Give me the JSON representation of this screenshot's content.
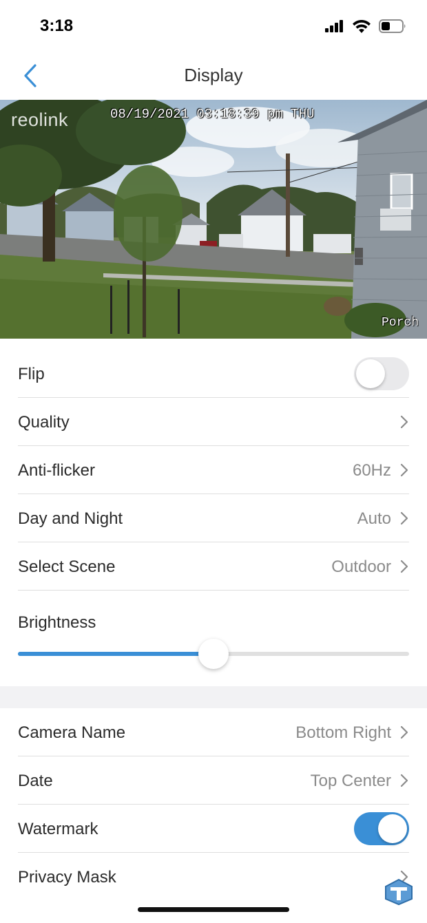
{
  "status_bar": {
    "time": "3:18"
  },
  "nav": {
    "title": "Display"
  },
  "preview": {
    "logo": "reolink",
    "date_overlay": "08/19/2021 03:18:39 pm THU",
    "camera_name_overlay": "Porch"
  },
  "settings": {
    "flip": {
      "label": "Flip",
      "enabled": false
    },
    "quality": {
      "label": "Quality"
    },
    "anti_flicker": {
      "label": "Anti-flicker",
      "value": "60Hz"
    },
    "day_night": {
      "label": "Day and Night",
      "value": "Auto"
    },
    "scene": {
      "label": "Select Scene",
      "value": "Outdoor"
    },
    "brightness": {
      "label": "Brightness",
      "level_percent": 50
    }
  },
  "osd": {
    "camera_name": {
      "label": "Camera Name",
      "value": "Bottom Right"
    },
    "date": {
      "label": "Date",
      "value": "Top Center"
    },
    "watermark": {
      "label": "Watermark",
      "enabled": true
    },
    "privacy_mask": {
      "label": "Privacy Mask"
    }
  },
  "colors": {
    "accent": "#3a8fd6",
    "toggle_off": "#e9e9eb"
  }
}
